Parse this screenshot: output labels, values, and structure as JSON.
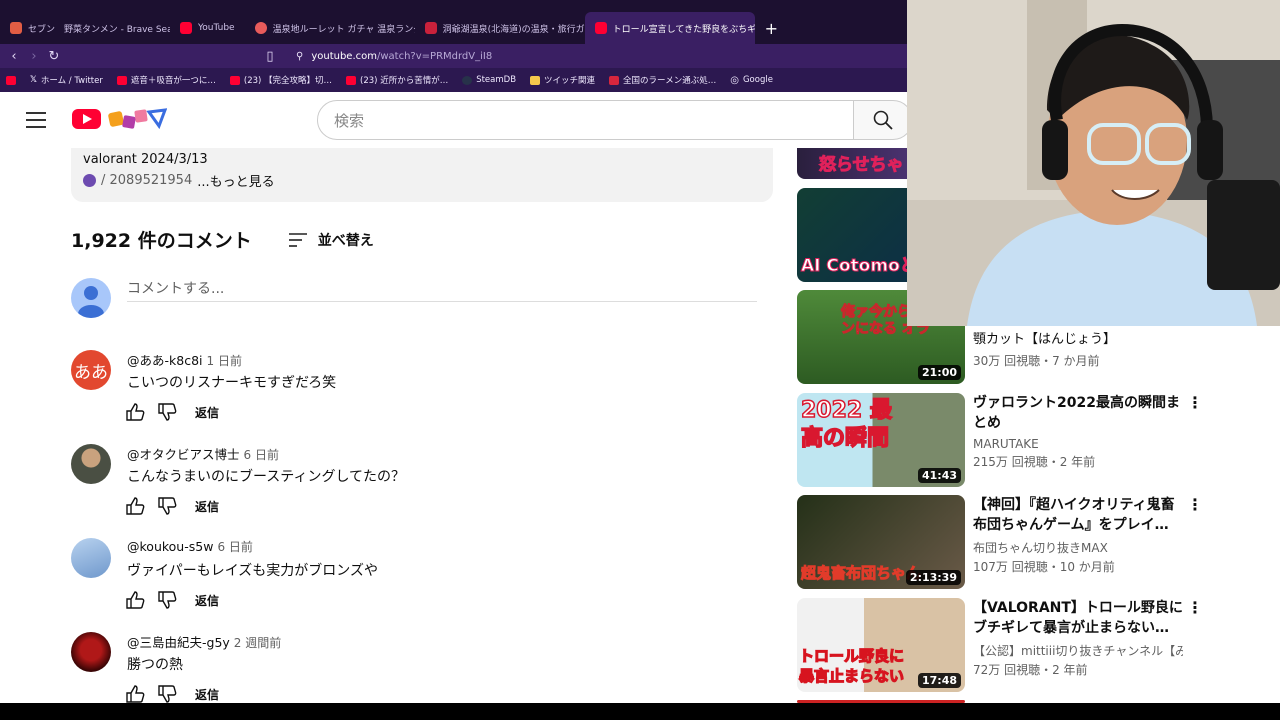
{
  "browser": {
    "tabs": [
      {
        "label": "セブン　野菜タンメン - Brave Search",
        "color": "#e25d44"
      },
      {
        "label": "YouTube",
        "color": "#ff0033"
      },
      {
        "label": "温泉地ルーレット ガチャ 温泉ランダム表示",
        "color": "#e85b5b"
      },
      {
        "label": "洞爺湖温泉(北海道)の温泉・旅行ガイド",
        "color": "#c9213b"
      },
      {
        "label": "トロール宣言してきた野良をぶちギレ",
        "color": "#ff0033",
        "close": "×"
      }
    ],
    "new_tab": "+",
    "url_host": "youtube.com",
    "url_path": "/watch?v=PRMdrdV_iI8",
    "bookmarks": [
      {
        "label": "",
        "color": "#ff0033"
      },
      {
        "label": "ホーム / Twitter",
        "color": "#111111"
      },
      {
        "label": "遮音＋吸音が一つに…",
        "color": "#ff0033"
      },
      {
        "label": "(23) 【完全攻略】切…",
        "color": "#ff0033"
      },
      {
        "label": "(23) 近所から苦情が…",
        "color": "#ff0033"
      },
      {
        "label": "SteamDB",
        "color": "#27324a"
      },
      {
        "label": "ツイッチ関連",
        "color": "#f5c84c"
      },
      {
        "label": "全国のラーメン通ぶ処…",
        "color": "#d7263d"
      },
      {
        "label": "Google",
        "color": "#ffffff"
      }
    ]
  },
  "youtube": {
    "search_placeholder": "検索"
  },
  "description": {
    "line1": "valorant  2024/3/13",
    "handle": "/ 2089521954",
    "more": "...もっと見る"
  },
  "comments_header": {
    "count": "1,922 件のコメント",
    "sort": "並べ替え",
    "add_placeholder": "コメントする..."
  },
  "comments": [
    {
      "author": "@ああ-k8c8i",
      "time": "1 日前",
      "text": "こいつのリスナーキモすぎだろ笑",
      "avatar_text": "ああ",
      "avatar_color": "#e2482f",
      "reply": "返信"
    },
    {
      "author": "@オタクビアス博士",
      "time": "6 日前",
      "text": "こんなうまいのにブースティングしてたの？",
      "avatar_text": "",
      "avatar_color": "#4a4f43",
      "reply": "返信"
    },
    {
      "author": "@koukou-s5w",
      "time": "6 日前",
      "text": "ヴァイパーもレイズも実力がブロンズや",
      "avatar_text": "",
      "avatar_color": "#8fb3dd",
      "reply": "返信"
    },
    {
      "author": "@三島由紀夫-g5y",
      "time": "2 週間前",
      "text": "勝つの熱",
      "avatar_text": "",
      "avatar_color": "#7a1212",
      "reply": "返信"
    }
  ],
  "related": [
    {
      "thumb_text": "怒らせちゃ",
      "duration": "",
      "title": "",
      "channel": "",
      "views": "",
      "c1": "#2a1f3d",
      "c2": "#f04f7a"
    },
    {
      "thumb_text": "AI Cotomoと1",
      "duration": "",
      "title": "",
      "channel": "",
      "views": "",
      "c1": "#123e34",
      "c2": "#e0215b"
    },
    {
      "thumb_text": "俺ァ今から バケモンになる オラ",
      "duration": "21:00",
      "title": "顎カット【はんじょう】",
      "channel": "",
      "views": "30万 回視聴・7 か月前",
      "c1": "#3d7a2b",
      "c2": "#c9272c"
    },
    {
      "thumb_text": "2022 最高の瞬間",
      "duration": "41:43",
      "title": "ヴァロラント2022最高の瞬間まとめ",
      "channel": "MARUTAKE",
      "views": "215万 回視聴・2 年前",
      "c1": "#8fd4e8",
      "c2": "#d9182f"
    },
    {
      "thumb_text": "超鬼畜布団ちゃん",
      "duration": "2:13:39",
      "title": "【神回】『超ハイクオリティ鬼畜布団ちゃんゲーム』をプレイ…",
      "channel": "布団ちゃん切り抜きMAX",
      "views": "107万 回視聴・10 か月前",
      "c1": "#1f2a14",
      "c2": "#e13b2a"
    },
    {
      "thumb_text": "トロール野良に 暴言止まらない",
      "duration": "17:48",
      "title": "【VALORANT】トロール野良にブチギレて暴言が止まらない…",
      "channel": "【公認】mittiii切り抜きチャンネル【み…",
      "views": "72万 回視聴・2 年前",
      "c1": "#f1f1f1",
      "c2": "#d7141f"
    }
  ]
}
